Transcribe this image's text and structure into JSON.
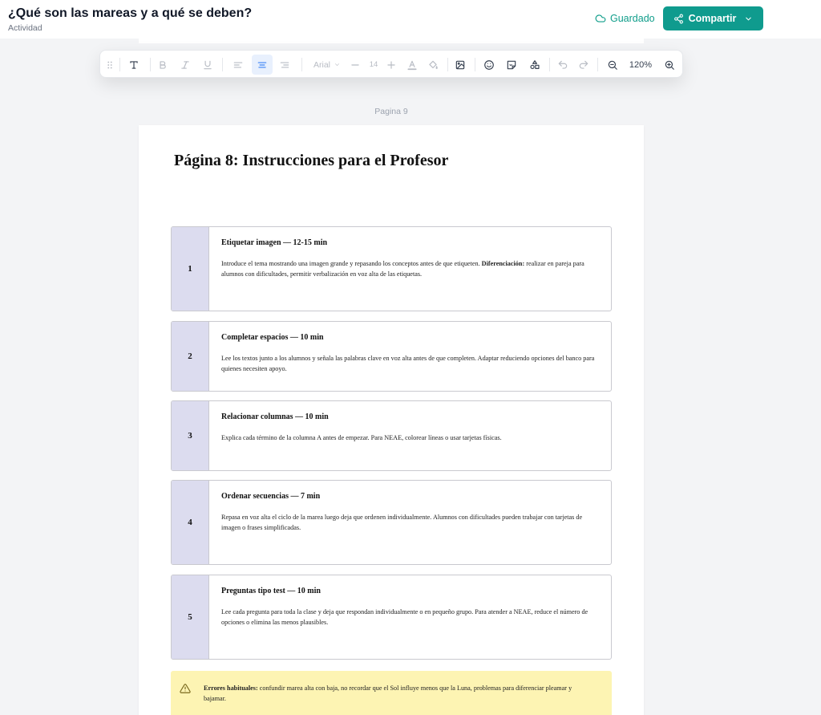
{
  "header": {
    "title": "¿Qué son las mareas y a qué se deben?",
    "subtitle": "Actividad",
    "saved_label": "Guardado",
    "share_label": "Compartir"
  },
  "toolbar": {
    "font_name": "Arial",
    "font_size": "14",
    "zoom": "120%"
  },
  "page_label": "Pagina 9",
  "page": {
    "title": "Página 8: Instrucciones para el Profesor",
    "cards": [
      {
        "number": "1",
        "title": "Etiquetar imagen — 12-15 min",
        "text_before": "Introduce el tema mostrando una imagen grande y repasando los conceptos antes de que etiqueten. ",
        "text_bold": "Diferenciación:",
        "text_after": " realizar en pareja para alumnos con dificultades, permitir verbalización en voz alta de las etiquetas."
      },
      {
        "number": "2",
        "title": "Completar espacios — 10 min",
        "text": "Lee los textos junto a los alumnos y señala las palabras clave en voz alta antes de que completen. Adaptar reduciendo opciones del banco para quienes necesiten apoyo."
      },
      {
        "number": "3",
        "title": "Relacionar columnas — 10 min",
        "text": "Explica cada término de la columna A antes de empezar. Para NEAE, colorear líneas o usar tarjetas físicas."
      },
      {
        "number": "4",
        "title": "Ordenar secuencias — 7 min",
        "text": "Repasa en voz alta el ciclo de la marea luego deja que ordenen individualmente. Alumnos con dificultades pueden trabajar con tarjetas de imagen o frases simplificadas."
      },
      {
        "number": "5",
        "title": "Preguntas tipo test — 10 min",
        "text": "Lee cada pregunta para toda la clase y deja que respondan individualmente o en pequeño grupo. Para atender a NEAE, reduce el número de opciones o elimina las menos plausibles."
      }
    ],
    "warning": {
      "label": "Errores habituales:",
      "text": " confundir marea alta con baja, no recordar que el Sol influye menos que la Luna, problemas para diferenciar pleamar y bajamar."
    }
  },
  "colors": {
    "accent": "#0f9b8e",
    "saved": "#0f9d8a",
    "number_column": "#dcdcef",
    "warning_bg": "#fdf4b3"
  },
  "icons": {
    "saved": "cloud-icon",
    "share": "share-icon",
    "warning": "warning-triangle-icon"
  }
}
